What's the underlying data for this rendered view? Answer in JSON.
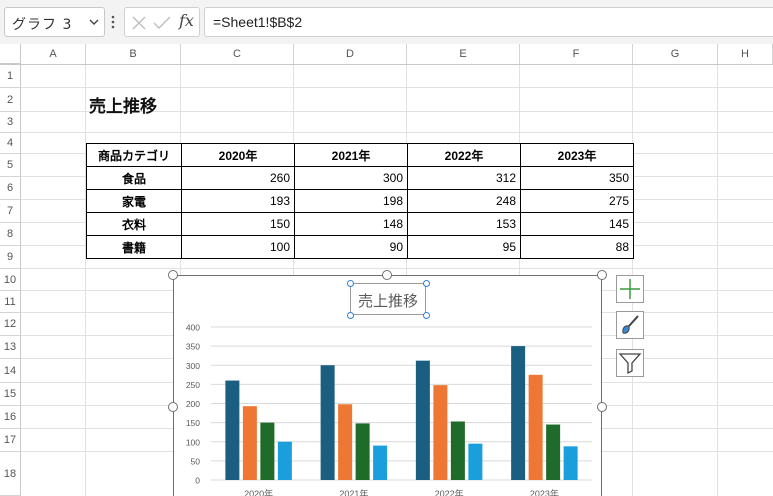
{
  "formula_bar": {
    "name_box": "グラフ 3",
    "fx_label": "fx",
    "formula": "=Sheet1!$B$2"
  },
  "grid": {
    "columns": [
      "A",
      "B",
      "C",
      "D",
      "E",
      "F",
      "G",
      "H"
    ],
    "rows": [
      "1",
      "2",
      "3",
      "4",
      "5",
      "6",
      "7",
      "8",
      "9",
      "10",
      "11",
      "12",
      "13",
      "14",
      "15",
      "16",
      "17",
      "18"
    ]
  },
  "sheet": {
    "title": "売上推移",
    "table": {
      "header": [
        "商品カテゴリ",
        "2020年",
        "2021年",
        "2022年",
        "2023年"
      ],
      "rows": [
        {
          "category": "食品",
          "values": [
            "260",
            "300",
            "312",
            "350"
          ]
        },
        {
          "category": "家電",
          "values": [
            "193",
            "198",
            "248",
            "275"
          ]
        },
        {
          "category": "衣料",
          "values": [
            "150",
            "148",
            "153",
            "145"
          ]
        },
        {
          "category": "書籍",
          "values": [
            "100",
            "90",
            "95",
            "88"
          ]
        }
      ]
    }
  },
  "chart_data": {
    "type": "bar",
    "title": "売上推移",
    "categories": [
      "2020年",
      "2021年",
      "2022年",
      "2023年"
    ],
    "series": [
      {
        "values": [
          260,
          300,
          312,
          350
        ],
        "color": "#1a5e80"
      },
      {
        "values": [
          193,
          198,
          248,
          275
        ],
        "color": "#ee7733"
      },
      {
        "values": [
          150,
          148,
          153,
          145
        ],
        "color": "#1e6b2a"
      },
      {
        "values": [
          100,
          90,
          95,
          88
        ],
        "color": "#1b9fdc"
      }
    ],
    "y_ticks": [
      "0",
      "50",
      "100",
      "150",
      "200",
      "250",
      "300",
      "350",
      "400"
    ],
    "ylim": [
      0,
      400
    ],
    "grid": true
  },
  "chart_side_buttons": [
    "chart-elements-plus-icon",
    "chart-styles-brush-icon",
    "chart-filters-funnel-icon"
  ]
}
